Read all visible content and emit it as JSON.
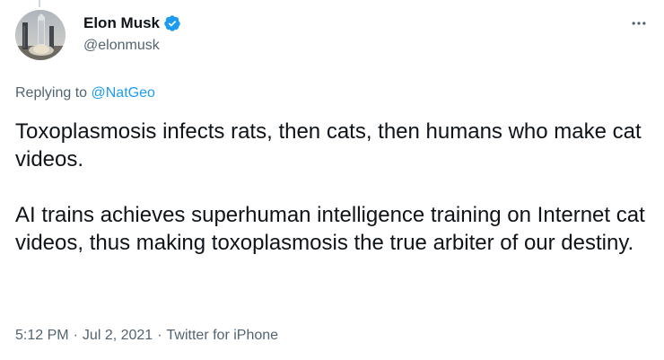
{
  "tweet": {
    "author": {
      "display_name": "Elon Musk",
      "handle": "@elonmusk",
      "verified": true,
      "avatar": "rocket-launch-photo"
    },
    "replying_to": {
      "prefix": "Replying to",
      "mention": "@NatGeo"
    },
    "paragraphs": [
      "Toxoplasmosis infects rats, then cats, then humans who make cat videos.",
      "AI trains achieves superhuman intelligence training on Internet cat videos, thus making toxoplasmosis the true arbiter of our destiny."
    ],
    "meta": {
      "time": "5:12 PM",
      "separator": "·",
      "date": "Jul 2, 2021",
      "source": "Twitter for iPhone"
    },
    "colors": {
      "accent": "#1d9bf0",
      "secondary_text": "#536471",
      "primary_text": "#0f1419"
    },
    "icons": {
      "more": "more-horizontal-icon",
      "verified": "verified-badge-icon"
    }
  }
}
